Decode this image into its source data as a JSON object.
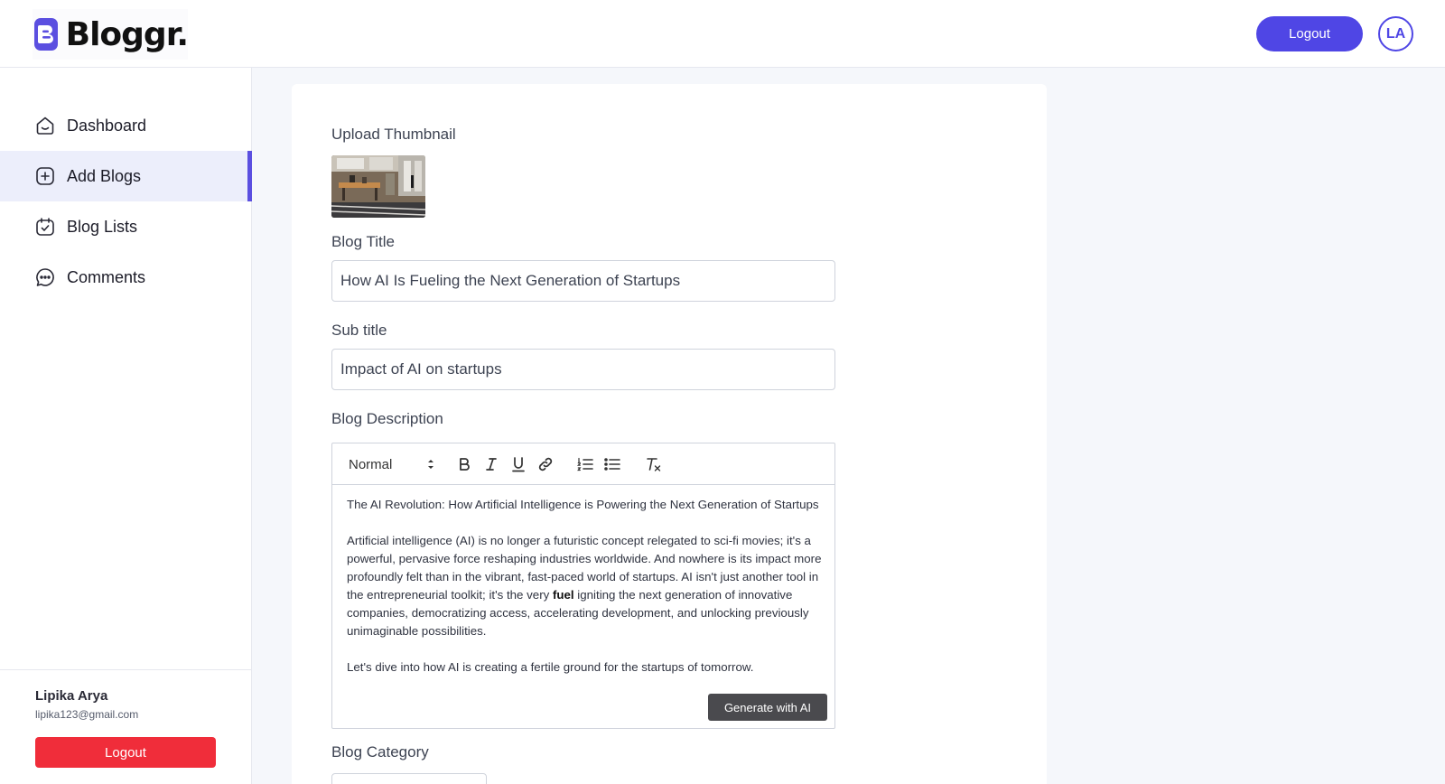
{
  "brand": {
    "name": "Bloggr.",
    "icon": "blogger-logo-icon",
    "accent": "#4f46e5"
  },
  "header": {
    "logout_label": "Logout",
    "avatar_initials": "LA"
  },
  "sidebar": {
    "items": [
      {
        "label": "Dashboard",
        "icon": "home-icon"
      },
      {
        "label": "Add Blogs",
        "icon": "add-square-icon",
        "active": true
      },
      {
        "label": "Blog Lists",
        "icon": "calendar-check-icon"
      },
      {
        "label": "Comments",
        "icon": "chat-bubble-icon"
      }
    ],
    "user": {
      "name": "Lipika Arya",
      "email": "lipika123@gmail.com"
    },
    "logout_label": "Logout",
    "logout_color": "#f02d3a"
  },
  "form": {
    "thumbnail_label": "Upload Thumbnail",
    "title_label": "Blog Title",
    "title_value": "How AI Is Fueling the Next Generation of Startups",
    "subtitle_label": "Sub title",
    "subtitle_value": "Impact of AI on startups",
    "description_label": "Blog Description",
    "editor": {
      "format_select": "Normal",
      "toolbar_icons": [
        "bold-icon",
        "italic-icon",
        "underline-icon",
        "link-icon",
        "ordered-list-icon",
        "bullet-list-icon",
        "clear-format-icon"
      ],
      "para1": "The AI Revolution: How Artificial Intelligence is Powering the Next Generation of Startups",
      "para2_before": "Artificial intelligence (AI) is no longer a futuristic concept relegated to sci-fi movies; it's a powerful, pervasive force reshaping industries worldwide. And nowhere is its impact more profoundly felt than in the vibrant, fast-paced world of startups. AI isn't just another tool in the entrepreneurial toolkit; it's the very ",
      "para2_bold": "fuel",
      "para2_after": " igniting the next generation of innovative companies, democratizing access, accelerating development, and unlocking previously unimaginable possibilities.",
      "para3": "Let's dive into how AI is creating a fertile ground for the startups of tomorrow.",
      "generate_label": "Generate with AI"
    },
    "category_label": "Blog Category"
  }
}
